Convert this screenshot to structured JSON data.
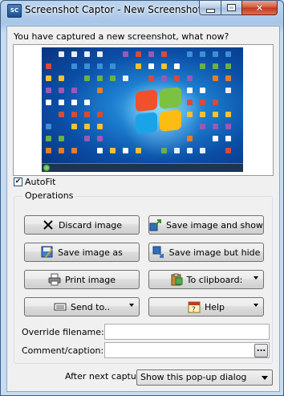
{
  "window": {
    "title": "Screenshot Captor - New Screenshot",
    "app_icon_text": "SC",
    "min_label": "",
    "max_label": "",
    "close_label": "✕"
  },
  "main": {
    "headline": "You have captured a new screenshot, what now?",
    "autofit": {
      "label": "AutoFit",
      "checked": true
    },
    "operations": {
      "title": "Operations",
      "buttons": [
        {
          "label": "Discard image",
          "icon": "x-icon"
        },
        {
          "label": "Save image and show",
          "icon": "save-show-icon"
        },
        {
          "label": "Save image as",
          "icon": "save-as-icon"
        },
        {
          "label": "Save image but hide",
          "icon": "save-hide-icon"
        },
        {
          "label": "Print image",
          "icon": "printer-icon"
        },
        {
          "label": "To clipboard:",
          "icon": "clipboard-icon",
          "dropdown": true
        },
        {
          "label": "Send to..",
          "icon": "keyboard-icon",
          "dropdown": true
        },
        {
          "label": "Help",
          "icon": "help-calendar-icon",
          "dropdown": true
        }
      ],
      "override_filename": {
        "label": "Override filename:",
        "value": ""
      },
      "comment_caption": {
        "label": "Comment/caption:",
        "value": "",
        "browse_label": "..."
      }
    },
    "after_capture": {
      "label": "After next capture:",
      "selected": "Show this pop-up dialog"
    }
  }
}
